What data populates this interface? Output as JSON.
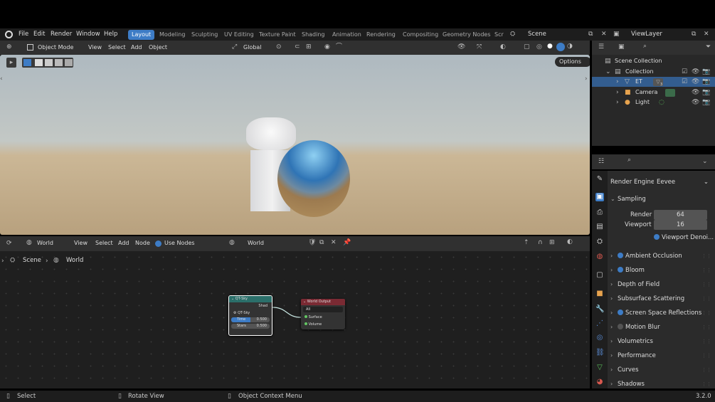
{
  "menu": {
    "file": "File",
    "edit": "Edit",
    "render": "Render",
    "window": "Window",
    "help": "Help"
  },
  "workspaces": [
    "Layout",
    "Modeling",
    "Sculpting",
    "UV Editing",
    "Texture Paint",
    "Shading",
    "Animation",
    "Rendering",
    "Compositing",
    "Geometry Nodes",
    "Scr"
  ],
  "scene_name": "Scene",
  "view_layer": "ViewLayer",
  "viewport_header": {
    "mode": "Object Mode",
    "view": "View",
    "select": "Select",
    "add": "Add",
    "object": "Object",
    "orientation": "Global",
    "options": "Options"
  },
  "node_header": {
    "world_type": "World",
    "view": "View",
    "select": "Select",
    "add": "Add",
    "node": "Node",
    "use_nodes": "Use Nodes",
    "world_name": "World"
  },
  "breadcrumb": {
    "scene": "Scene",
    "world": "World"
  },
  "nodes": {
    "sky": {
      "title": "QT-Sky",
      "output": "Shad",
      "group": "QT-Sky",
      "time_label": "Time",
      "time_value": "0.500",
      "stars_label": "Stars",
      "stars_value": "0.500"
    },
    "world_output": {
      "title": "World Output",
      "target": "All",
      "surface": "Surface",
      "volume": "Volume"
    }
  },
  "outliner": {
    "root": "Scene Collection",
    "collection": "Collection",
    "objects": [
      {
        "name": "ET",
        "badge": "3"
      },
      {
        "name": "Camera"
      },
      {
        "name": "Light"
      }
    ]
  },
  "properties": {
    "render_engine_label": "Render Engine",
    "render_engine": "Eevee",
    "sampling": "Sampling",
    "render_label": "Render",
    "render_value": "64",
    "viewport_label": "Viewport",
    "viewport_value": "16",
    "viewport_denoise": "Viewport Denoi...",
    "sections": [
      {
        "label": "Ambient Occlusion",
        "checkbox": true,
        "on": true
      },
      {
        "label": "Bloom",
        "checkbox": true,
        "on": true
      },
      {
        "label": "Depth of Field",
        "checkbox": false
      },
      {
        "label": "Subsurface Scattering",
        "checkbox": false
      },
      {
        "label": "Screen Space Reflections",
        "checkbox": true,
        "on": true
      },
      {
        "label": "Motion Blur",
        "checkbox": true,
        "on": false
      },
      {
        "label": "Volumetrics",
        "checkbox": false
      },
      {
        "label": "Performance",
        "checkbox": false
      },
      {
        "label": "Curves",
        "checkbox": false
      },
      {
        "label": "Shadows",
        "checkbox": false
      }
    ]
  },
  "status": {
    "select": "Select",
    "rotate": "Rotate View",
    "context": "Object Context Menu",
    "version": "3.2.0"
  },
  "colors": {
    "accent": "#3d7cc6",
    "selected_row": "#335d8f",
    "sky_node_header": "#2b6f6a",
    "output_node_header": "#7a2a33"
  }
}
